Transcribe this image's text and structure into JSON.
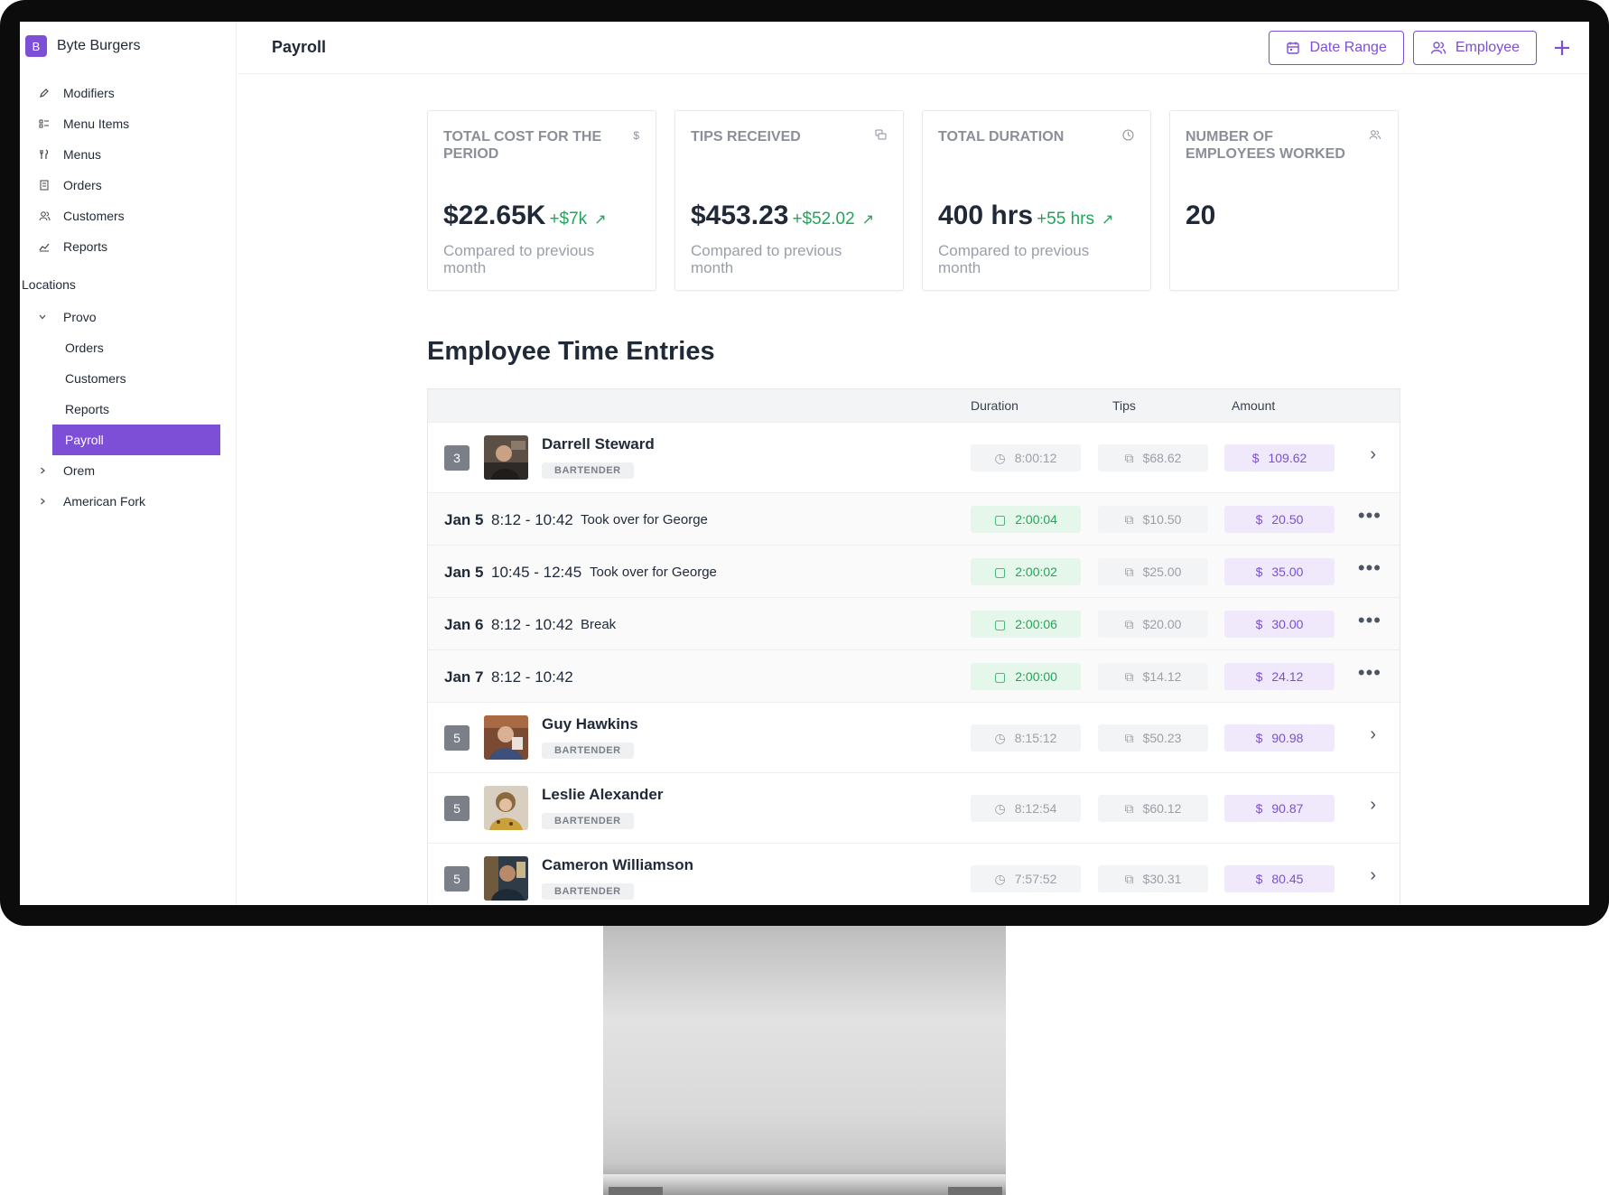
{
  "brand": {
    "initial": "B",
    "name": "Byte Burgers"
  },
  "nav": {
    "items": [
      {
        "label": "Modifiers",
        "icon": "pen-icon"
      },
      {
        "label": "Menu Items",
        "icon": "list-icon"
      },
      {
        "label": "Menus",
        "icon": "utensils-icon"
      },
      {
        "label": "Orders",
        "icon": "receipt-icon"
      },
      {
        "label": "Customers",
        "icon": "users-icon"
      },
      {
        "label": "Reports",
        "icon": "chart-icon"
      }
    ],
    "locations_label": "Locations",
    "locations": [
      {
        "label": "Provo",
        "expanded": true,
        "children": [
          "Orders",
          "Customers",
          "Reports",
          "Payroll"
        ]
      },
      {
        "label": "Orem",
        "expanded": false
      },
      {
        "label": "American Fork",
        "expanded": false
      }
    ],
    "active": "Payroll"
  },
  "header": {
    "title": "Payroll",
    "date_range_label": "Date Range",
    "employee_label": "Employee",
    "add_label": "+"
  },
  "cards": [
    {
      "title": "TOTAL COST FOR THE PERIOD",
      "icon": "dollar-icon",
      "value": "$22.65K",
      "delta": "+$7k",
      "sub": "Compared to previous month"
    },
    {
      "title": "TIPS RECEIVED",
      "icon": "coins-icon",
      "value": "$453.23",
      "delta": "+$52.02",
      "sub": "Compared to previous month"
    },
    {
      "title": "TOTAL DURATION",
      "icon": "clock-icon",
      "value": "400 hrs",
      "delta": "+55 hrs",
      "sub": "Compared to previous month"
    },
    {
      "title": "NUMBER OF EMPLOYEES WORKED",
      "icon": "users-icon",
      "value": "20",
      "delta": "",
      "sub": ""
    }
  ],
  "section_title": "Employee Time Entries",
  "table": {
    "columns": [
      "Duration",
      "Tips",
      "Amount"
    ],
    "employees": [
      {
        "rank": "3",
        "name": "Darrell Steward",
        "role": "BARTENDER",
        "duration": "8:00:12",
        "tips": "$68.62",
        "amount": "109.62"
      },
      {
        "rank": "5",
        "name": "Guy Hawkins",
        "role": "BARTENDER",
        "duration": "8:15:12",
        "tips": "$50.23",
        "amount": "90.98"
      },
      {
        "rank": "5",
        "name": "Leslie Alexander",
        "role": "BARTENDER",
        "duration": "8:12:54",
        "tips": "$60.12",
        "amount": "90.87"
      },
      {
        "rank": "5",
        "name": "Cameron Williamson",
        "role": "BARTENDER",
        "duration": "7:57:52",
        "tips": "$30.31",
        "amount": "80.45"
      }
    ],
    "entries": [
      {
        "date": "Jan 5",
        "time": "8:12 - 10:42",
        "note": "Took over for George",
        "duration": "2:00:04",
        "tips": "$10.50",
        "amount": "20.50"
      },
      {
        "date": "Jan 5",
        "time": "10:45 - 12:45",
        "note": "Took over for George",
        "duration": "2:00:02",
        "tips": "$25.00",
        "amount": "35.00"
      },
      {
        "date": "Jan 6",
        "time": "8:12 - 10:42",
        "note": "Break",
        "duration": "2:00:06",
        "tips": "$20.00",
        "amount": "30.00"
      },
      {
        "date": "Jan 7",
        "time": "8:12 - 10:42",
        "note": "",
        "duration": "2:00:00",
        "tips": "$14.12",
        "amount": "24.12"
      }
    ],
    "currency_symbol": "$"
  },
  "colors": {
    "accent": "#7c4fd6",
    "positive": "#22a55a"
  }
}
